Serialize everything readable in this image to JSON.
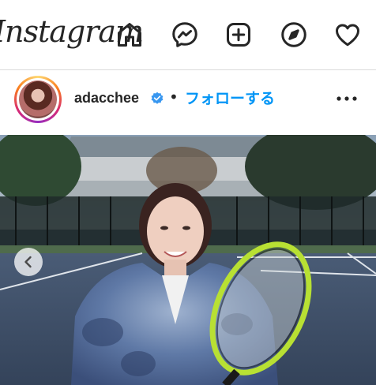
{
  "topbar": {
    "logo_text": "Instagram",
    "icons": [
      "home-icon",
      "messenger-icon",
      "new-post-icon",
      "explore-icon",
      "activity-heart-icon"
    ]
  },
  "post": {
    "username": "adacchee",
    "verified": true,
    "separator": "•",
    "follow_label": "フォローする",
    "more_icon": "more-options-icon"
  },
  "photo": {
    "alt_subject": "woman-with-tennis-racket",
    "prev_icon": "chevron-left-icon"
  },
  "colors": {
    "accent": "#0095f6",
    "verified": "#3897f0",
    "border": "#dbdbdb"
  }
}
